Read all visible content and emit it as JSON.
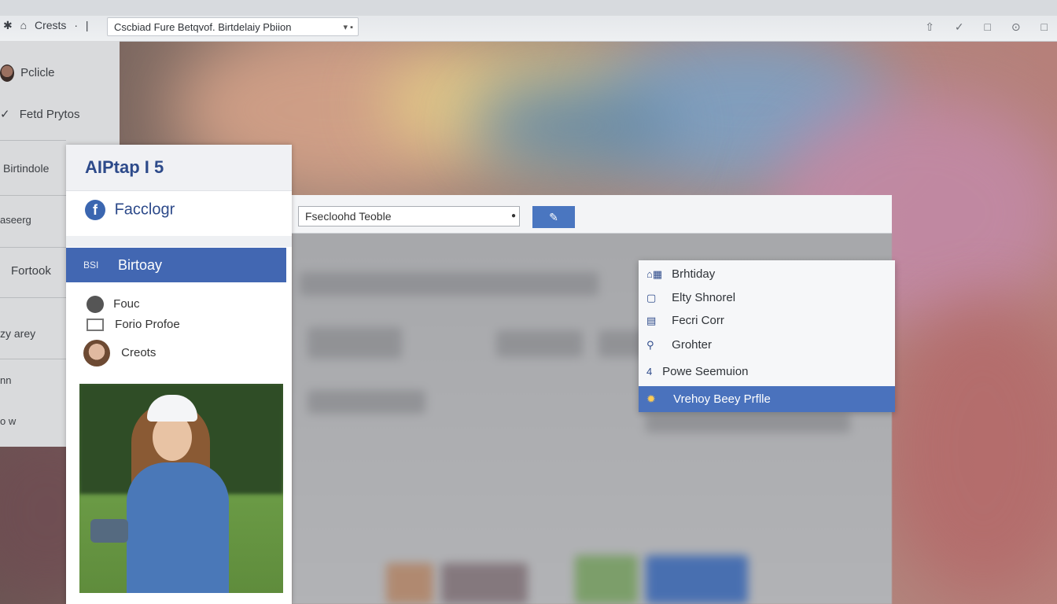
{
  "browser": {
    "nav_left": [
      "✱",
      "⌂",
      "Crests",
      "·",
      "|"
    ],
    "address": "Cscbiad Fure Betqvof. Birtdelaiy Pbiion",
    "address_arrow": "▾ ▪",
    "nav_right": [
      "⇧",
      "✓",
      "□",
      "⊙",
      "□"
    ]
  },
  "sidebar": {
    "items": [
      "Pclicle",
      "Fetd Prytos",
      "Birtindole",
      "aseerg",
      "Fortook",
      "zy arey",
      "nn",
      "o w"
    ],
    "check": "✓"
  },
  "card": {
    "title": "AIPtap I 5",
    "brand": "Facclogr",
    "brand_logo": "f",
    "active_tag": "BSI",
    "active_label": "Birtoay",
    "list": [
      "Fouc",
      "Forio Profoe",
      "Creots"
    ]
  },
  "search": {
    "value": "Fsecloohd Teoble",
    "button_icon": "✎"
  },
  "menu": {
    "items": [
      {
        "icon": "⌂▦",
        "label": "Brhtiday"
      },
      {
        "icon": "▢",
        "label": "Elty Shnorel"
      },
      {
        "icon": "▤",
        "label": "Fecri Corr"
      },
      {
        "icon": "⚲",
        "label": "Grohter"
      },
      {
        "icon": "4",
        "label": "Powe Seemuion"
      }
    ],
    "selected": {
      "icon": "✹",
      "label": "Vrehoy Beey Prflle"
    }
  },
  "colors": {
    "accent": "#4267b2",
    "menu_selected": "#4a72bd",
    "brand_text": "#2d4a8a"
  }
}
